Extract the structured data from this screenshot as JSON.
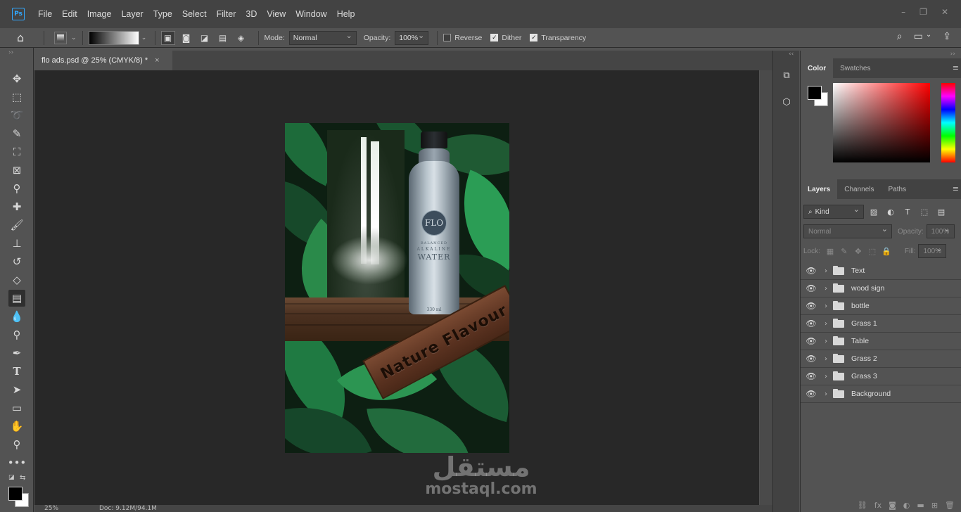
{
  "app": {
    "logo_text": "Ps",
    "menu": [
      "File",
      "Edit",
      "Image",
      "Layer",
      "Type",
      "Select",
      "Filter",
      "3D",
      "View",
      "Window",
      "Help"
    ],
    "window_controls": [
      "–",
      "❐",
      "✕"
    ]
  },
  "options_bar": {
    "mode_label": "Mode:",
    "mode_value": "Normal",
    "opacity_label": "Opacity:",
    "opacity_value": "100%",
    "reverse_label": "Reverse",
    "reverse_checked": false,
    "dither_label": "Dither",
    "dither_checked": true,
    "transparency_label": "Transparency",
    "transparency_checked": true
  },
  "document": {
    "tab_title": "flo ads.psd @ 25% (CMYK/8) *",
    "close_glyph": "×"
  },
  "poster": {
    "bottle_logo": "FLO",
    "bottle_line1": "BALANCED",
    "bottle_line2": "ALKALINE",
    "bottle_line3": "WATER",
    "bottle_volume": "330 ml",
    "sign_text": "Nature Flavour"
  },
  "watermark": {
    "arabic": "مستقل",
    "latin": "mostaql.com"
  },
  "status": {
    "zoom": "25%",
    "doc_size": "Doc: 9.12M/94.1M"
  },
  "color_panel": {
    "tabs": [
      "Color",
      "Swatches"
    ],
    "active_tab": "Color",
    "foreground": "#000000",
    "background": "#ffffff"
  },
  "layers_panel": {
    "tabs": [
      "Layers",
      "Channels",
      "Paths"
    ],
    "active_tab": "Layers",
    "filter_kind": "Kind",
    "blend_mode": "Normal",
    "opacity_label": "Opacity:",
    "opacity_value": "100%",
    "lock_label": "Lock:",
    "fill_label": "Fill:",
    "fill_value": "100%",
    "layers": [
      {
        "name": "Text"
      },
      {
        "name": "wood sign"
      },
      {
        "name": "bottle"
      },
      {
        "name": "Grass 1"
      },
      {
        "name": "Table"
      },
      {
        "name": "Grass 2"
      },
      {
        "name": "Grass 3"
      },
      {
        "name": "Background"
      }
    ]
  },
  "icons": {
    "home": "home-icon",
    "search": "search-icon",
    "workspace": "workspace-icon",
    "share": "share-icon"
  },
  "colors": {
    "chrome_dark": "#434343",
    "panel": "#535353",
    "canvas_bg": "#282828",
    "ps_blue": "#31a8ff"
  }
}
